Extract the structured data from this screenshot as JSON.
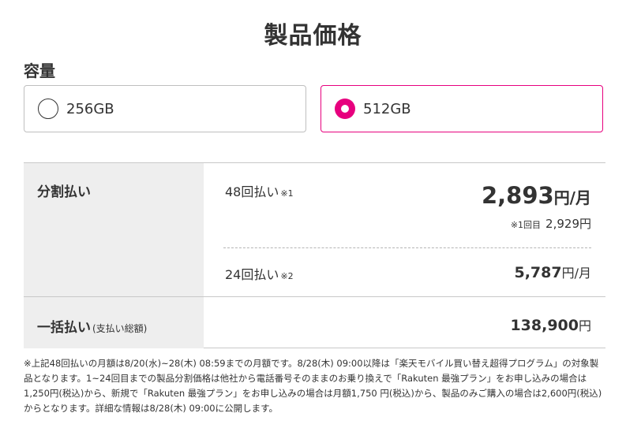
{
  "page": {
    "title": "製品価格"
  },
  "capacity": {
    "label": "容量",
    "options": [
      {
        "label": "256GB",
        "selected": false
      },
      {
        "label": "512GB",
        "selected": true
      }
    ]
  },
  "pricing": {
    "installment": {
      "category": "分割払い",
      "plan48": {
        "label": "48回払い",
        "note_mark": "※1",
        "price": "2,893",
        "unit": "円/月",
        "first_label": "※1回目",
        "first_price": "2,929円"
      },
      "plan24": {
        "label": "24回払い",
        "note_mark": "※2",
        "price": "5,787",
        "unit": "円/月"
      }
    },
    "lump_sum": {
      "category": "一括払い",
      "sub": "(支払い総額)",
      "price": "138,900",
      "unit": "円"
    }
  },
  "footnote": "※上記48回払いの月額は8/20(水)~28(木) 08:59までの月額です。8/28(木) 09:00以降は「楽天モバイル買い替え超得プログラム」の対象製品となります。1~24回目までの製品分割価格は他社から電話番号そのままのお乗り換えで「Rakuten 最強プラン」をお申し込みの場合は1,250円(税込)から、新規で「Rakuten 最強プラン」をお申し込みの場合は月額1,750 円(税込)から、製品のみご購入の場合は2,600円(税込)からとなります。詳細な情報は8/28(木) 09:00に公開します。",
  "colors": {
    "accent": "#e7007e",
    "text": "#333333",
    "table_header_bg": "#eeeeee"
  }
}
